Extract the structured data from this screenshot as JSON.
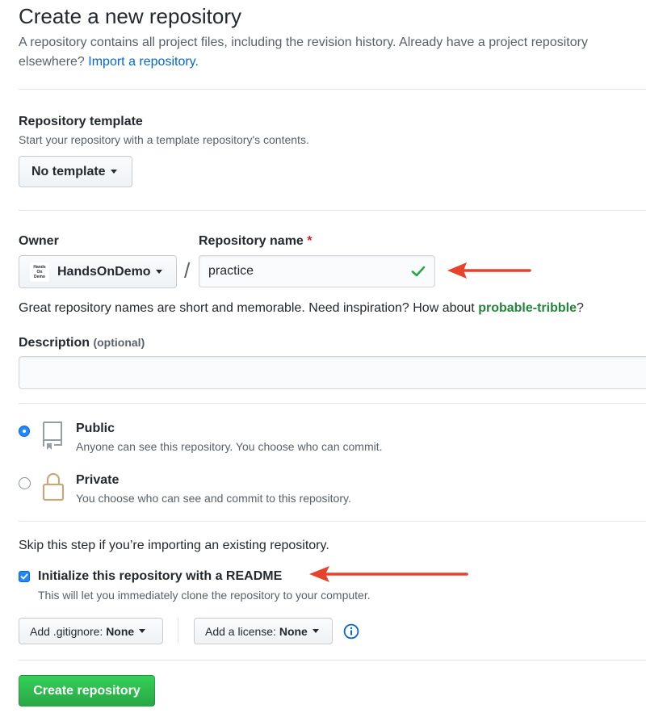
{
  "page": {
    "title": "Create a new repository",
    "intro_text": "A repository contains all project files, including the revision history. Already have a project repository elsewhere?",
    "import_link": "Import a repository."
  },
  "template": {
    "label": "Repository template",
    "help": "Start your repository with a template repository's contents.",
    "selected": "No template"
  },
  "owner": {
    "label": "Owner",
    "selected": "HandsOnDemo",
    "avatar_lines": [
      "Hands",
      "On",
      "Demo"
    ]
  },
  "separator": "/",
  "repo_name": {
    "label": "Repository name",
    "required_mark": "*",
    "value": "practice"
  },
  "name_hint": {
    "text": "Great repository names are short and memorable. Need inspiration? How about",
    "suggestion": "probable-tribble",
    "suffix": "?"
  },
  "description": {
    "label": "Description",
    "optional": "(optional)",
    "value": ""
  },
  "visibility": {
    "public_label": "Public",
    "public_help": "Anyone can see this repository. You choose who can commit.",
    "private_label": "Private",
    "private_help": "You choose who can see and commit to this repository.",
    "selected": "public"
  },
  "init": {
    "skip_note": "Skip this step if you’re importing an existing repository.",
    "readme_label": "Initialize this repository with a README",
    "readme_help": "This will let you immediately clone the repository to your computer.",
    "readme_checked": true
  },
  "gitignore": {
    "prefix": "Add .gitignore:",
    "value": "None"
  },
  "license": {
    "prefix": "Add a license:",
    "value": "None"
  },
  "submit_label": "Create repository",
  "colors": {
    "arrow": "#e8412c",
    "check": "#28a745",
    "primary": "#28a745",
    "link": "#0366d6"
  }
}
